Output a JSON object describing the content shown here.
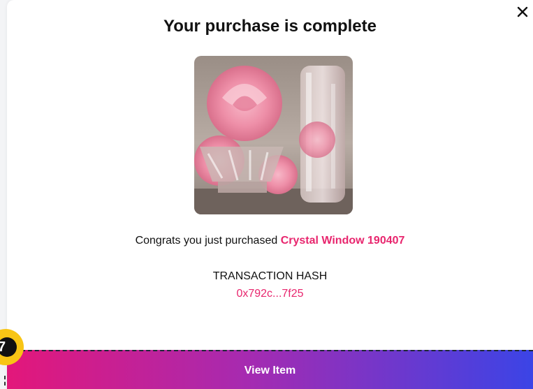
{
  "modal": {
    "title": "Your purchase is complete",
    "close_icon": "close-icon",
    "congrats_prefix": "Congrats you just purchased ",
    "item_name": "Crystal Window 190407",
    "hash_label": "TRANSACTION HASH",
    "hash_value": "0x792c...7f25",
    "view_button_label": "View Item"
  },
  "step_badge": {
    "number": "7"
  },
  "colors": {
    "accent_pink": "#e8266e",
    "gradient_start": "#e3177a",
    "gradient_end": "#3b44e6",
    "badge_yellow": "#f8c515"
  }
}
